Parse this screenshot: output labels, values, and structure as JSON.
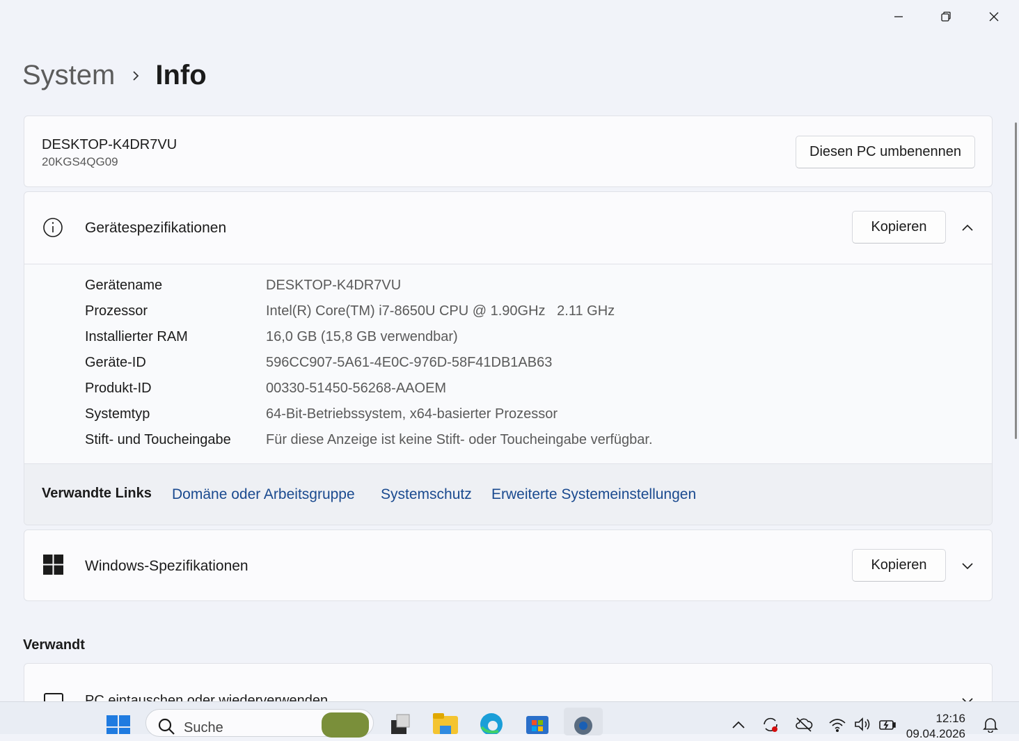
{
  "window": {
    "controls": {
      "minimize": "minimize-icon",
      "maximize": "restore-icon",
      "close": "close-icon"
    }
  },
  "breadcrumb": {
    "parent": "System",
    "separator": "chevron-right-icon",
    "current": "Info"
  },
  "pc": {
    "name": "DESKTOP-K4DR7VU",
    "model": "20KGS4QG09",
    "rename_label": "Diesen PC umbenennen"
  },
  "device_specs": {
    "icon": "info-icon",
    "title": "Gerätespezifikationen",
    "copy_label": "Kopieren",
    "expanded": true,
    "rows": [
      {
        "label": "Gerätename",
        "value": "DESKTOP-K4DR7VU"
      },
      {
        "label": "Prozessor",
        "value": "Intel(R) Core(TM) i7-8650U CPU @ 1.90GHz   2.11 GHz"
      },
      {
        "label": "Installierter RAM",
        "value": "16,0 GB (15,8 GB verwendbar)"
      },
      {
        "label": "Geräte-ID",
        "value": "596CC907-5A61-4E0C-976D-58F41DB1AB63"
      },
      {
        "label": "Produkt-ID",
        "value": "00330-51450-56268-AAOEM"
      },
      {
        "label": "Systemtyp",
        "value": "64-Bit-Betriebssystem, x64-basierter Prozessor"
      },
      {
        "label": "Stift- und Toucheingabe",
        "value": "Für diese Anzeige ist keine Stift- oder Toucheingabe verfügbar."
      }
    ],
    "related_links": {
      "title": "Verwandte Links",
      "links": [
        "Domäne oder Arbeitsgruppe",
        "Systemschutz",
        "Erweiterte Systemeinstellungen"
      ]
    }
  },
  "windows_specs": {
    "icon": "windows-logo-icon",
    "title": "Windows-Spezifikationen",
    "copy_label": "Kopieren",
    "expanded": false
  },
  "related": {
    "title": "Verwandt",
    "items": [
      {
        "label": "PC eintauschen oder wiederverwenden",
        "icon": "laptop-icon"
      }
    ]
  },
  "taskbar": {
    "search_placeholder": "Suche",
    "clock_time": "12:16",
    "clock_date": "09.04.2026",
    "apps": [
      "start-icon",
      "task-view-icon",
      "file-explorer-icon",
      "edge-icon",
      "store-icon",
      "settings-icon"
    ],
    "tray": [
      "chevron-up-icon",
      "sync-icon",
      "cloud-off-icon",
      "wifi-icon",
      "volume-icon",
      "battery-icon",
      "bell-icon"
    ]
  },
  "colors": {
    "accent_link": "#1a4a8f",
    "background": "#f1f3f9",
    "card": "#fbfbfd"
  }
}
